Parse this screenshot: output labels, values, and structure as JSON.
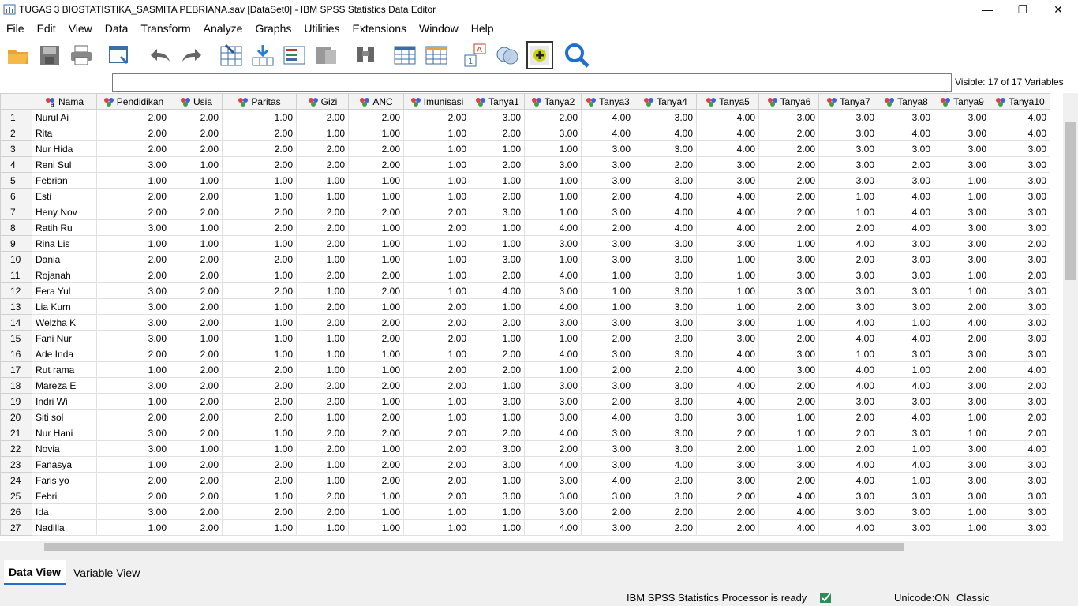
{
  "window": {
    "title": "TUGAS 3 BIOSTATISTIKA_SASMITA PEBRIANA.sav [DataSet0] - IBM SPSS Statistics Data Editor",
    "minimize": "—",
    "restore": "❐",
    "close": "✕"
  },
  "menu": [
    "File",
    "Edit",
    "View",
    "Data",
    "Transform",
    "Analyze",
    "Graphs",
    "Utilities",
    "Extensions",
    "Window",
    "Help"
  ],
  "cell_editor": {
    "value": "",
    "visible_label": "Visible: 17 of 17 Variables"
  },
  "columns": [
    "Nama",
    "Pendidikan",
    "Usia",
    "Paritas",
    "Gizi",
    "ANC",
    "Imunisasi",
    "Tanya1",
    "Tanya2",
    "Tanya3",
    "Tanya4",
    "Tanya5",
    "Tanya6",
    "Tanya7",
    "Tanya8",
    "Tanya9",
    "Tanya10"
  ],
  "rows": [
    [
      "Nurul Ai",
      "2.00",
      "2.00",
      "1.00",
      "2.00",
      "2.00",
      "2.00",
      "3.00",
      "2.00",
      "4.00",
      "3.00",
      "4.00",
      "3.00",
      "3.00",
      "3.00",
      "3.00",
      "4.00"
    ],
    [
      "Rita",
      "2.00",
      "2.00",
      "2.00",
      "1.00",
      "1.00",
      "1.00",
      "2.00",
      "3.00",
      "4.00",
      "4.00",
      "4.00",
      "2.00",
      "3.00",
      "4.00",
      "3.00",
      "4.00"
    ],
    [
      "Nur Hida",
      "2.00",
      "2.00",
      "2.00",
      "2.00",
      "2.00",
      "1.00",
      "1.00",
      "1.00",
      "3.00",
      "3.00",
      "4.00",
      "2.00",
      "3.00",
      "3.00",
      "3.00",
      "3.00"
    ],
    [
      "Reni Sul",
      "3.00",
      "1.00",
      "2.00",
      "2.00",
      "2.00",
      "1.00",
      "2.00",
      "3.00",
      "3.00",
      "2.00",
      "3.00",
      "2.00",
      "3.00",
      "2.00",
      "3.00",
      "3.00"
    ],
    [
      "Febrian",
      "1.00",
      "1.00",
      "1.00",
      "1.00",
      "1.00",
      "1.00",
      "1.00",
      "1.00",
      "3.00",
      "3.00",
      "3.00",
      "2.00",
      "3.00",
      "3.00",
      "1.00",
      "3.00"
    ],
    [
      "Esti",
      "2.00",
      "2.00",
      "1.00",
      "1.00",
      "1.00",
      "1.00",
      "2.00",
      "1.00",
      "2.00",
      "4.00",
      "4.00",
      "2.00",
      "1.00",
      "4.00",
      "1.00",
      "3.00"
    ],
    [
      "Heny Nov",
      "2.00",
      "2.00",
      "2.00",
      "2.00",
      "2.00",
      "2.00",
      "3.00",
      "1.00",
      "3.00",
      "4.00",
      "4.00",
      "2.00",
      "1.00",
      "4.00",
      "3.00",
      "3.00"
    ],
    [
      "Ratih Ru",
      "3.00",
      "1.00",
      "2.00",
      "2.00",
      "1.00",
      "2.00",
      "1.00",
      "4.00",
      "2.00",
      "4.00",
      "4.00",
      "2.00",
      "2.00",
      "4.00",
      "3.00",
      "3.00"
    ],
    [
      "Rina Lis",
      "1.00",
      "1.00",
      "1.00",
      "2.00",
      "1.00",
      "1.00",
      "1.00",
      "3.00",
      "3.00",
      "3.00",
      "3.00",
      "1.00",
      "4.00",
      "3.00",
      "3.00",
      "2.00"
    ],
    [
      "Dania",
      "2.00",
      "2.00",
      "2.00",
      "1.00",
      "1.00",
      "1.00",
      "3.00",
      "1.00",
      "3.00",
      "3.00",
      "1.00",
      "3.00",
      "2.00",
      "3.00",
      "3.00",
      "3.00"
    ],
    [
      "Rojanah",
      "2.00",
      "2.00",
      "1.00",
      "2.00",
      "2.00",
      "1.00",
      "2.00",
      "4.00",
      "1.00",
      "3.00",
      "1.00",
      "3.00",
      "3.00",
      "3.00",
      "1.00",
      "2.00"
    ],
    [
      "Fera Yul",
      "3.00",
      "2.00",
      "2.00",
      "1.00",
      "2.00",
      "1.00",
      "4.00",
      "3.00",
      "1.00",
      "3.00",
      "1.00",
      "3.00",
      "3.00",
      "3.00",
      "1.00",
      "3.00"
    ],
    [
      "Lia Kurn",
      "3.00",
      "2.00",
      "1.00",
      "2.00",
      "1.00",
      "2.00",
      "1.00",
      "4.00",
      "1.00",
      "3.00",
      "1.00",
      "2.00",
      "3.00",
      "3.00",
      "2.00",
      "3.00"
    ],
    [
      "Welzha K",
      "3.00",
      "2.00",
      "1.00",
      "2.00",
      "2.00",
      "2.00",
      "2.00",
      "3.00",
      "3.00",
      "3.00",
      "3.00",
      "1.00",
      "4.00",
      "1.00",
      "4.00",
      "3.00"
    ],
    [
      "Fani Nur",
      "3.00",
      "1.00",
      "1.00",
      "1.00",
      "2.00",
      "2.00",
      "1.00",
      "1.00",
      "2.00",
      "2.00",
      "3.00",
      "2.00",
      "4.00",
      "4.00",
      "2.00",
      "3.00"
    ],
    [
      "Ade Inda",
      "2.00",
      "2.00",
      "1.00",
      "1.00",
      "1.00",
      "1.00",
      "2.00",
      "4.00",
      "3.00",
      "3.00",
      "4.00",
      "3.00",
      "1.00",
      "3.00",
      "3.00",
      "3.00"
    ],
    [
      "Rut rama",
      "1.00",
      "2.00",
      "2.00",
      "1.00",
      "1.00",
      "2.00",
      "2.00",
      "1.00",
      "2.00",
      "2.00",
      "4.00",
      "3.00",
      "4.00",
      "1.00",
      "2.00",
      "4.00"
    ],
    [
      "Mareza E",
      "3.00",
      "2.00",
      "2.00",
      "2.00",
      "2.00",
      "2.00",
      "1.00",
      "3.00",
      "3.00",
      "3.00",
      "4.00",
      "2.00",
      "4.00",
      "4.00",
      "3.00",
      "2.00"
    ],
    [
      "Indri Wi",
      "1.00",
      "2.00",
      "2.00",
      "2.00",
      "1.00",
      "1.00",
      "3.00",
      "3.00",
      "2.00",
      "3.00",
      "4.00",
      "2.00",
      "3.00",
      "3.00",
      "3.00",
      "3.00"
    ],
    [
      "Siti sol",
      "2.00",
      "2.00",
      "2.00",
      "1.00",
      "2.00",
      "1.00",
      "1.00",
      "3.00",
      "4.00",
      "3.00",
      "3.00",
      "1.00",
      "2.00",
      "4.00",
      "1.00",
      "2.00"
    ],
    [
      "Nur Hani",
      "3.00",
      "2.00",
      "1.00",
      "2.00",
      "2.00",
      "2.00",
      "2.00",
      "4.00",
      "3.00",
      "3.00",
      "2.00",
      "1.00",
      "2.00",
      "3.00",
      "1.00",
      "2.00"
    ],
    [
      "Novia",
      "3.00",
      "1.00",
      "1.00",
      "2.00",
      "1.00",
      "2.00",
      "3.00",
      "2.00",
      "3.00",
      "3.00",
      "2.00",
      "1.00",
      "2.00",
      "1.00",
      "3.00",
      "4.00"
    ],
    [
      "Fanasya",
      "1.00",
      "2.00",
      "2.00",
      "1.00",
      "2.00",
      "2.00",
      "3.00",
      "4.00",
      "3.00",
      "4.00",
      "3.00",
      "3.00",
      "4.00",
      "4.00",
      "3.00",
      "3.00"
    ],
    [
      "Faris yo",
      "2.00",
      "2.00",
      "2.00",
      "1.00",
      "2.00",
      "2.00",
      "1.00",
      "3.00",
      "4.00",
      "2.00",
      "3.00",
      "2.00",
      "4.00",
      "1.00",
      "3.00",
      "3.00"
    ],
    [
      "Febri",
      "2.00",
      "2.00",
      "1.00",
      "2.00",
      "1.00",
      "2.00",
      "3.00",
      "3.00",
      "3.00",
      "3.00",
      "2.00",
      "4.00",
      "3.00",
      "3.00",
      "3.00",
      "3.00"
    ],
    [
      "Ida",
      "3.00",
      "2.00",
      "2.00",
      "2.00",
      "1.00",
      "1.00",
      "1.00",
      "3.00",
      "2.00",
      "2.00",
      "2.00",
      "4.00",
      "3.00",
      "3.00",
      "1.00",
      "3.00"
    ],
    [
      "Nadilla",
      "1.00",
      "2.00",
      "1.00",
      "1.00",
      "1.00",
      "1.00",
      "1.00",
      "4.00",
      "3.00",
      "2.00",
      "2.00",
      "4.00",
      "4.00",
      "3.00",
      "1.00",
      "3.00"
    ]
  ],
  "tabs": {
    "data_view": "Data View",
    "variable_view": "Variable View"
  },
  "status": {
    "processor": "IBM SPSS Statistics Processor is ready",
    "unicode": "Unicode:ON",
    "mode": "Classic"
  }
}
